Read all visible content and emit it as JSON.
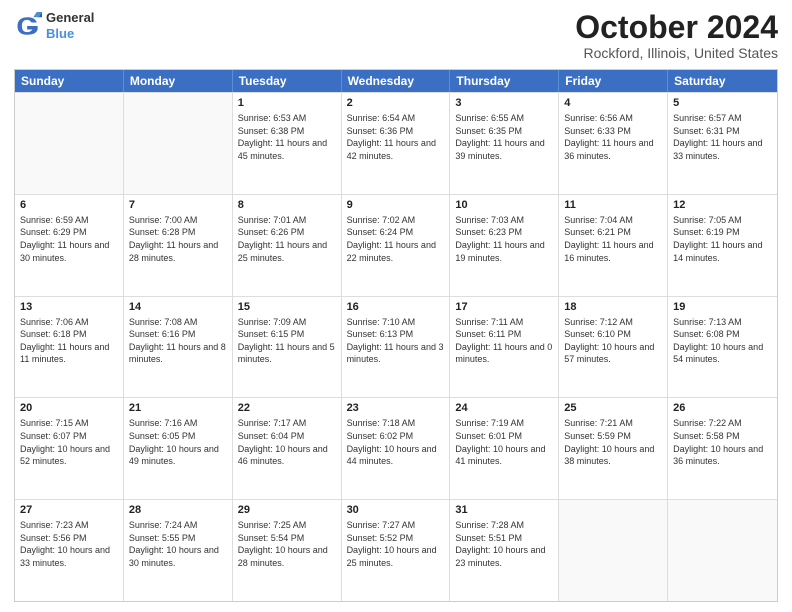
{
  "header": {
    "logo_line1": "General",
    "logo_line2": "Blue",
    "month_title": "October 2024",
    "location": "Rockford, Illinois, United States"
  },
  "days_of_week": [
    "Sunday",
    "Monday",
    "Tuesday",
    "Wednesday",
    "Thursday",
    "Friday",
    "Saturday"
  ],
  "weeks": [
    [
      {
        "day": "",
        "sunrise": "",
        "sunset": "",
        "daylight": ""
      },
      {
        "day": "",
        "sunrise": "",
        "sunset": "",
        "daylight": ""
      },
      {
        "day": "1",
        "sunrise": "Sunrise: 6:53 AM",
        "sunset": "Sunset: 6:38 PM",
        "daylight": "Daylight: 11 hours and 45 minutes."
      },
      {
        "day": "2",
        "sunrise": "Sunrise: 6:54 AM",
        "sunset": "Sunset: 6:36 PM",
        "daylight": "Daylight: 11 hours and 42 minutes."
      },
      {
        "day": "3",
        "sunrise": "Sunrise: 6:55 AM",
        "sunset": "Sunset: 6:35 PM",
        "daylight": "Daylight: 11 hours and 39 minutes."
      },
      {
        "day": "4",
        "sunrise": "Sunrise: 6:56 AM",
        "sunset": "Sunset: 6:33 PM",
        "daylight": "Daylight: 11 hours and 36 minutes."
      },
      {
        "day": "5",
        "sunrise": "Sunrise: 6:57 AM",
        "sunset": "Sunset: 6:31 PM",
        "daylight": "Daylight: 11 hours and 33 minutes."
      }
    ],
    [
      {
        "day": "6",
        "sunrise": "Sunrise: 6:59 AM",
        "sunset": "Sunset: 6:29 PM",
        "daylight": "Daylight: 11 hours and 30 minutes."
      },
      {
        "day": "7",
        "sunrise": "Sunrise: 7:00 AM",
        "sunset": "Sunset: 6:28 PM",
        "daylight": "Daylight: 11 hours and 28 minutes."
      },
      {
        "day": "8",
        "sunrise": "Sunrise: 7:01 AM",
        "sunset": "Sunset: 6:26 PM",
        "daylight": "Daylight: 11 hours and 25 minutes."
      },
      {
        "day": "9",
        "sunrise": "Sunrise: 7:02 AM",
        "sunset": "Sunset: 6:24 PM",
        "daylight": "Daylight: 11 hours and 22 minutes."
      },
      {
        "day": "10",
        "sunrise": "Sunrise: 7:03 AM",
        "sunset": "Sunset: 6:23 PM",
        "daylight": "Daylight: 11 hours and 19 minutes."
      },
      {
        "day": "11",
        "sunrise": "Sunrise: 7:04 AM",
        "sunset": "Sunset: 6:21 PM",
        "daylight": "Daylight: 11 hours and 16 minutes."
      },
      {
        "day": "12",
        "sunrise": "Sunrise: 7:05 AM",
        "sunset": "Sunset: 6:19 PM",
        "daylight": "Daylight: 11 hours and 14 minutes."
      }
    ],
    [
      {
        "day": "13",
        "sunrise": "Sunrise: 7:06 AM",
        "sunset": "Sunset: 6:18 PM",
        "daylight": "Daylight: 11 hours and 11 minutes."
      },
      {
        "day": "14",
        "sunrise": "Sunrise: 7:08 AM",
        "sunset": "Sunset: 6:16 PM",
        "daylight": "Daylight: 11 hours and 8 minutes."
      },
      {
        "day": "15",
        "sunrise": "Sunrise: 7:09 AM",
        "sunset": "Sunset: 6:15 PM",
        "daylight": "Daylight: 11 hours and 5 minutes."
      },
      {
        "day": "16",
        "sunrise": "Sunrise: 7:10 AM",
        "sunset": "Sunset: 6:13 PM",
        "daylight": "Daylight: 11 hours and 3 minutes."
      },
      {
        "day": "17",
        "sunrise": "Sunrise: 7:11 AM",
        "sunset": "Sunset: 6:11 PM",
        "daylight": "Daylight: 11 hours and 0 minutes."
      },
      {
        "day": "18",
        "sunrise": "Sunrise: 7:12 AM",
        "sunset": "Sunset: 6:10 PM",
        "daylight": "Daylight: 10 hours and 57 minutes."
      },
      {
        "day": "19",
        "sunrise": "Sunrise: 7:13 AM",
        "sunset": "Sunset: 6:08 PM",
        "daylight": "Daylight: 10 hours and 54 minutes."
      }
    ],
    [
      {
        "day": "20",
        "sunrise": "Sunrise: 7:15 AM",
        "sunset": "Sunset: 6:07 PM",
        "daylight": "Daylight: 10 hours and 52 minutes."
      },
      {
        "day": "21",
        "sunrise": "Sunrise: 7:16 AM",
        "sunset": "Sunset: 6:05 PM",
        "daylight": "Daylight: 10 hours and 49 minutes."
      },
      {
        "day": "22",
        "sunrise": "Sunrise: 7:17 AM",
        "sunset": "Sunset: 6:04 PM",
        "daylight": "Daylight: 10 hours and 46 minutes."
      },
      {
        "day": "23",
        "sunrise": "Sunrise: 7:18 AM",
        "sunset": "Sunset: 6:02 PM",
        "daylight": "Daylight: 10 hours and 44 minutes."
      },
      {
        "day": "24",
        "sunrise": "Sunrise: 7:19 AM",
        "sunset": "Sunset: 6:01 PM",
        "daylight": "Daylight: 10 hours and 41 minutes."
      },
      {
        "day": "25",
        "sunrise": "Sunrise: 7:21 AM",
        "sunset": "Sunset: 5:59 PM",
        "daylight": "Daylight: 10 hours and 38 minutes."
      },
      {
        "day": "26",
        "sunrise": "Sunrise: 7:22 AM",
        "sunset": "Sunset: 5:58 PM",
        "daylight": "Daylight: 10 hours and 36 minutes."
      }
    ],
    [
      {
        "day": "27",
        "sunrise": "Sunrise: 7:23 AM",
        "sunset": "Sunset: 5:56 PM",
        "daylight": "Daylight: 10 hours and 33 minutes."
      },
      {
        "day": "28",
        "sunrise": "Sunrise: 7:24 AM",
        "sunset": "Sunset: 5:55 PM",
        "daylight": "Daylight: 10 hours and 30 minutes."
      },
      {
        "day": "29",
        "sunrise": "Sunrise: 7:25 AM",
        "sunset": "Sunset: 5:54 PM",
        "daylight": "Daylight: 10 hours and 28 minutes."
      },
      {
        "day": "30",
        "sunrise": "Sunrise: 7:27 AM",
        "sunset": "Sunset: 5:52 PM",
        "daylight": "Daylight: 10 hours and 25 minutes."
      },
      {
        "day": "31",
        "sunrise": "Sunrise: 7:28 AM",
        "sunset": "Sunset: 5:51 PM",
        "daylight": "Daylight: 10 hours and 23 minutes."
      },
      {
        "day": "",
        "sunrise": "",
        "sunset": "",
        "daylight": ""
      },
      {
        "day": "",
        "sunrise": "",
        "sunset": "",
        "daylight": ""
      }
    ]
  ]
}
